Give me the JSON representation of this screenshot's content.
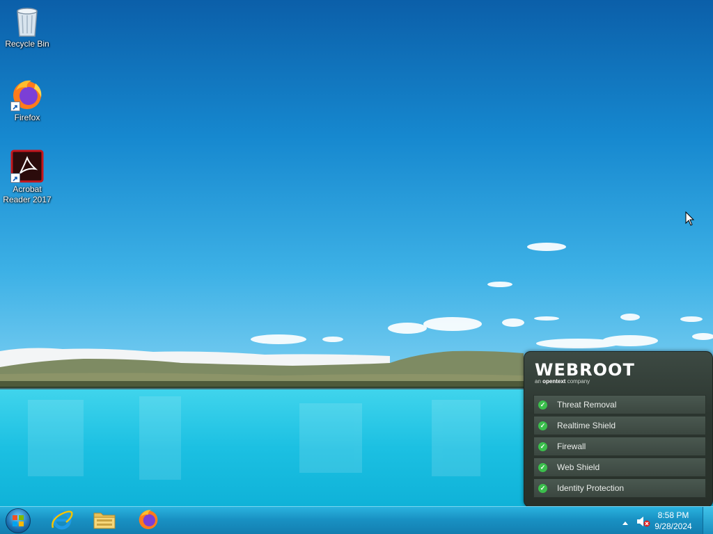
{
  "desktop": {
    "icons": [
      {
        "label": "Recycle Bin"
      },
      {
        "label": "Firefox"
      },
      {
        "label": "Acrobat Reader 2017"
      }
    ]
  },
  "webroot": {
    "brand": "WEBROOT",
    "brand_sub_prefix": "an ",
    "brand_sub_company": "opentext",
    "brand_sub_suffix": " company",
    "items": [
      {
        "label": "Threat Removal"
      },
      {
        "label": "Realtime Shield"
      },
      {
        "label": "Firewall"
      },
      {
        "label": "Web Shield"
      },
      {
        "label": "Identity Protection"
      }
    ],
    "status_color": "#3bbf4c"
  },
  "taskbar": {
    "pinned": [
      "internet-explorer-icon",
      "file-explorer-icon",
      "firefox-icon"
    ],
    "clock": {
      "time": "8:58 PM",
      "date": "9/28/2024"
    }
  }
}
